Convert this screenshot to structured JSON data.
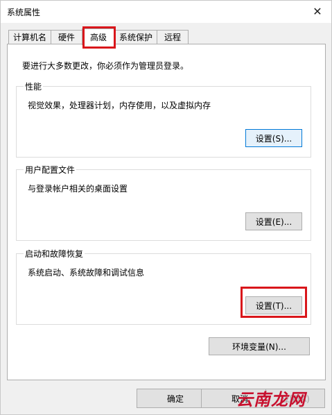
{
  "window": {
    "title": "系统属性"
  },
  "tabs": [
    {
      "label": "计算机名"
    },
    {
      "label": "硬件"
    },
    {
      "label": "高级"
    },
    {
      "label": "系统保护"
    },
    {
      "label": "远程"
    }
  ],
  "active_tab": "高级",
  "intro_text": "要进行大多数更改，你必须作为管理员登录。",
  "groups": {
    "performance": {
      "title": "性能",
      "description": "视觉效果，处理器计划，内存使用，以及虚拟内存",
      "button": "设置(S)..."
    },
    "user_profiles": {
      "title": "用户配置文件",
      "description": "与登录帐户相关的桌面设置",
      "button": "设置(E)..."
    },
    "startup_recovery": {
      "title": "启动和故障恢复",
      "description": "系统启动、系统故障和调试信息",
      "button": "设置(T)..."
    }
  },
  "env_button": "环境变量(N)...",
  "footer": {
    "ok": "确定",
    "cancel": "取消",
    "apply": "应用(A)"
  },
  "watermark": {
    "text": "云南龙网"
  },
  "colors": {
    "highlight": "#d9161b",
    "focus_border": "#0078d7",
    "watermark": "#c8102e"
  }
}
